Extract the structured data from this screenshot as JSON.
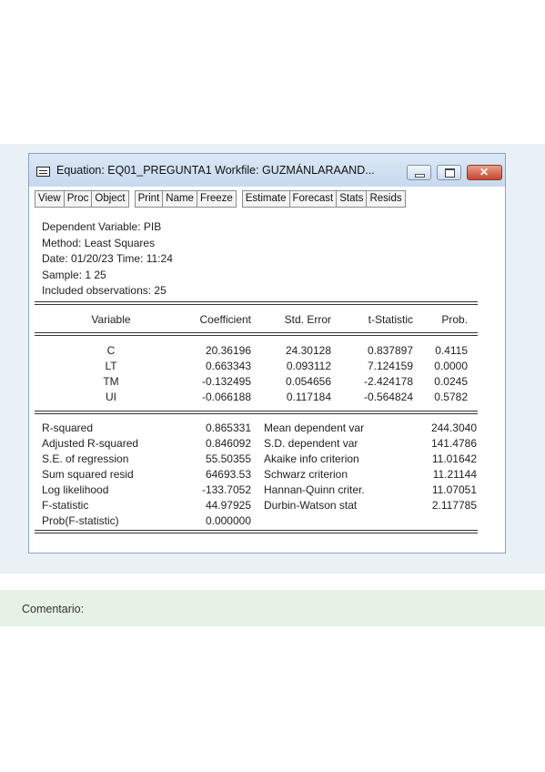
{
  "window": {
    "title": "Equation: EQ01_PREGUNTA1   Workfile: GUZMÁNLARAAND...",
    "icon": "window-menu-icon"
  },
  "toolbar": {
    "group1": [
      "View",
      "Proc",
      "Object"
    ],
    "group2": [
      "Print",
      "Name",
      "Freeze"
    ],
    "group3": [
      "Estimate",
      "Forecast",
      "Stats",
      "Resids"
    ]
  },
  "header": {
    "lines": [
      "Dependent Variable: PIB",
      "Method: Least Squares",
      "Date: 01/20/23   Time: 11:24",
      "Sample: 1 25",
      "Included observations: 25"
    ]
  },
  "coef_table": {
    "columns": [
      "Variable",
      "Coefficient",
      "Std. Error",
      "t-Statistic",
      "Prob."
    ],
    "rows": [
      [
        "C",
        "20.36196",
        "24.30128",
        "0.837897",
        "0.4115"
      ],
      [
        "LT",
        "0.663343",
        "0.093112",
        "7.124159",
        "0.0000"
      ],
      [
        "TM",
        "-0.132495",
        "0.054656",
        "-2.424178",
        "0.0245"
      ],
      [
        "UI",
        "-0.066188",
        "0.117184",
        "-0.564824",
        "0.5782"
      ]
    ]
  },
  "stats": {
    "left": [
      [
        "R-squared",
        "0.865331"
      ],
      [
        "Adjusted R-squared",
        "0.846092"
      ],
      [
        "S.E. of regression",
        "55.50355"
      ],
      [
        "Sum squared resid",
        "64693.53"
      ],
      [
        "Log likelihood",
        "-133.7052"
      ],
      [
        "F-statistic",
        "44.97925"
      ],
      [
        "Prob(F-statistic)",
        "0.000000"
      ]
    ],
    "right": [
      [
        "Mean dependent var",
        "244.3040"
      ],
      [
        "S.D. dependent var",
        "141.4786"
      ],
      [
        "Akaike info criterion",
        "11.01642"
      ],
      [
        "Schwarz criterion",
        "11.21144"
      ],
      [
        "Hannan-Quinn criter.",
        "11.07051"
      ],
      [
        "Durbin-Watson stat",
        "2.117785"
      ]
    ]
  },
  "comment": {
    "label": "Comentario:"
  }
}
